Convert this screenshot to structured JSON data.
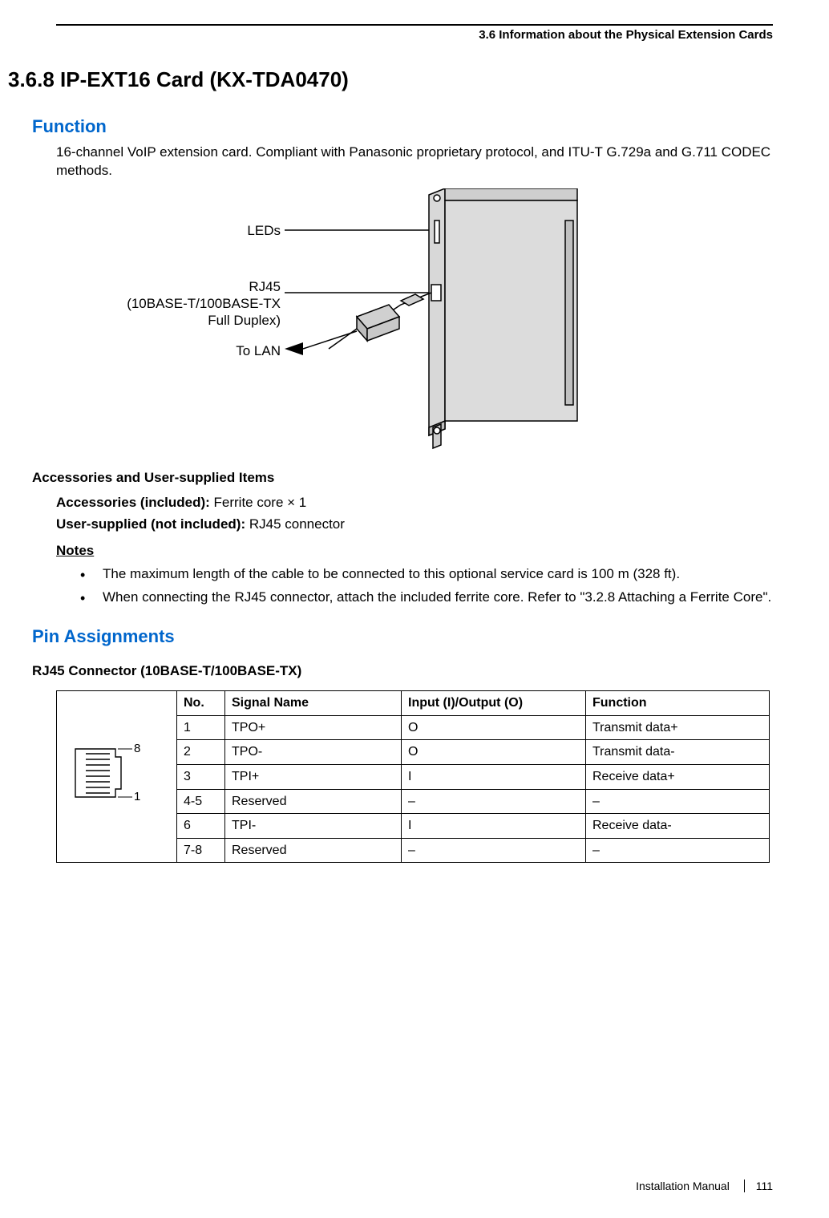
{
  "header": {
    "breadcrumb": "3.6 Information about the Physical Extension Cards"
  },
  "section": {
    "number_title": "3.6.8    IP-EXT16 Card (KX-TDA0470)"
  },
  "function": {
    "heading": "Function",
    "description": "16-channel VoIP extension card. Compliant with Panasonic proprietary protocol, and ITU-T G.729a and G.711 CODEC methods."
  },
  "diagram": {
    "label_leds": "LEDs",
    "label_rj45_line1": "RJ45",
    "label_rj45_line2": "(10BASE-T/100BASE-TX",
    "label_rj45_line3": "Full Duplex)",
    "label_lan": "To LAN"
  },
  "accessories": {
    "heading": "Accessories and User-supplied Items",
    "included_label": "Accessories (included): ",
    "included_value": "Ferrite core × 1",
    "user_label": "User-supplied (not included): ",
    "user_value": "RJ45 connector"
  },
  "notes": {
    "heading": "Notes",
    "items": [
      "The maximum length of the cable to be connected to this optional service card is 100 m (328 ft).",
      "When connecting the RJ45 connector, attach the included ferrite core. Refer to \"3.2.8 Attaching a Ferrite Core\"."
    ]
  },
  "pin": {
    "heading": "Pin Assignments",
    "connector_heading": "RJ45 Connector (10BASE-T/100BASE-TX)",
    "connector_label_top": "8",
    "connector_label_bottom": "1",
    "columns": {
      "no": "No.",
      "signal": "Signal Name",
      "io": "Input (I)/Output (O)",
      "func": "Function"
    },
    "rows": [
      {
        "no": "1",
        "signal": "TPO+",
        "io": "O",
        "func": "Transmit data+"
      },
      {
        "no": "2",
        "signal": "TPO-",
        "io": "O",
        "func": "Transmit data-"
      },
      {
        "no": "3",
        "signal": "TPI+",
        "io": "I",
        "func": "Receive data+"
      },
      {
        "no": "4-5",
        "signal": "Reserved",
        "io": "–",
        "func": "–"
      },
      {
        "no": "6",
        "signal": "TPI-",
        "io": "I",
        "func": "Receive data-"
      },
      {
        "no": "7-8",
        "signal": "Reserved",
        "io": "–",
        "func": "–"
      }
    ]
  },
  "footer": {
    "manual": "Installation Manual",
    "page": "111"
  }
}
